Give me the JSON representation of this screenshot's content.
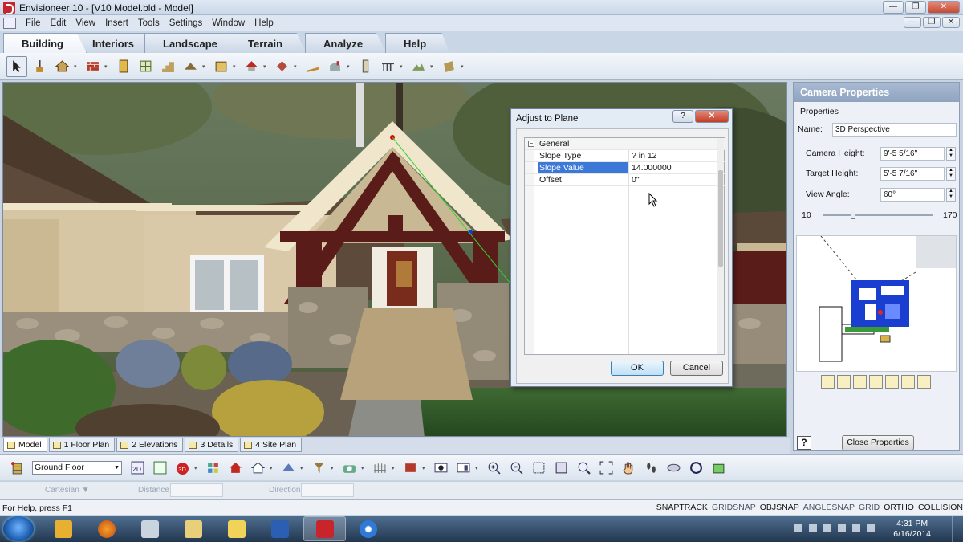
{
  "window": {
    "title": "Envisioneer 10 - [V10 Model.bld - Model]"
  },
  "menu": [
    "File",
    "Edit",
    "View",
    "Insert",
    "Tools",
    "Settings",
    "Window",
    "Help"
  ],
  "ribbon_tabs": [
    "Building",
    "Interiors",
    "Landscape",
    "Terrain",
    "Analyze",
    "Help"
  ],
  "dialog": {
    "title": "Adjust to Plane",
    "help_glyph": "?",
    "group": "General",
    "rows": [
      {
        "label": "Slope Type",
        "value": "? in 12"
      },
      {
        "label": "Slope Value",
        "value": "14.000000"
      },
      {
        "label": "Offset",
        "value": "0\""
      }
    ],
    "ok_label": "OK",
    "cancel_label": "Cancel"
  },
  "camera_panel": {
    "title": "Camera Properties",
    "section": "Properties",
    "name_label": "Name:",
    "name_value": "3D Perspective",
    "camera_height_label": "Camera Height:",
    "camera_height_value": "9'-5 5/16\"",
    "target_height_label": "Target Height:",
    "target_height_value": "5'-5 7/16\"",
    "view_angle_label": "View Angle:",
    "view_angle_value": "60°",
    "slider_min": "10",
    "slider_max": "170",
    "help_glyph": "?",
    "close_label": "Close Properties"
  },
  "view_tabs": [
    "Model",
    "1 Floor Plan",
    "2 Elevations",
    "3 Details",
    "4 Site Plan"
  ],
  "floor_select": "Ground Floor",
  "coord_row": {
    "mode": "Cartesian ▼",
    "distance": "Distance",
    "direction": "Direction"
  },
  "status": {
    "hint": "For Help, press F1",
    "snaps": [
      "SNAPTRACK",
      "GRIDSNAP",
      "OBJSNAP",
      "ANGLESNAP",
      "GRID",
      "ORTHO",
      "COLLISION"
    ]
  },
  "taskbar": {
    "time": "4:31 PM",
    "date": "6/16/2014"
  },
  "colors": {
    "accent": "#3b78d8",
    "roof": "#5e4a3a",
    "timber": "#5a1c18",
    "stucco": "#d9c9a8",
    "lawn": "#2f5a2a"
  }
}
